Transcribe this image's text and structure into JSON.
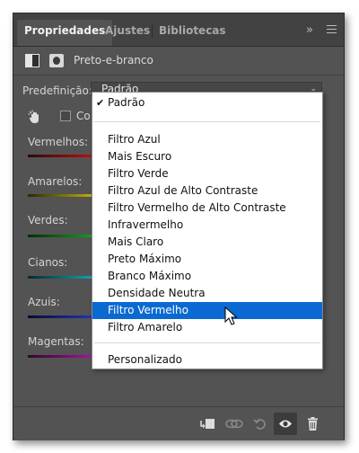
{
  "tabs": [
    {
      "label": "Propriedades",
      "active": true
    },
    {
      "label": "Ajustes",
      "active": false
    },
    {
      "label": "Bibliotecas",
      "active": false
    }
  ],
  "tab_overflow": "»",
  "adjustment": {
    "title": "Preto-e-branco",
    "icons": [
      "adjustment-layer-icon",
      "mask-icon"
    ]
  },
  "preset": {
    "label": "Predefinição:",
    "value": "Padrão"
  },
  "auto": {
    "label": "Co",
    "checked": false
  },
  "sliders": [
    {
      "label": "Vermelhos:",
      "colors": [
        "#2a0a0a",
        "#e01010"
      ]
    },
    {
      "label": "Amarelos:",
      "colors": [
        "#2a2a0a",
        "#e0d010"
      ]
    },
    {
      "label": "Verdes:",
      "colors": [
        "#0a2a0a",
        "#10c020"
      ]
    },
    {
      "label": "Cianos:",
      "colors": [
        "#0a2a2a",
        "#10c0d0"
      ]
    },
    {
      "label": "Azuis:",
      "colors": [
        "#0a0a2a",
        "#2040e0"
      ]
    },
    {
      "label": "Magentas:",
      "colors": [
        "#2a0a2a",
        "#d010c0"
      ]
    }
  ],
  "dropdown": {
    "items": [
      {
        "label": "Padrão",
        "checked": true
      },
      {
        "separator": true
      },
      {
        "label": "Filtro Azul"
      },
      {
        "label": "Mais Escuro"
      },
      {
        "label": "Filtro Verde"
      },
      {
        "label": "Filtro Azul de Alto Contraste"
      },
      {
        "label": "Filtro Vermelho de Alto Contraste"
      },
      {
        "label": "Infravermelho"
      },
      {
        "label": "Mais Claro"
      },
      {
        "label": "Preto Máximo"
      },
      {
        "label": "Branco Máximo"
      },
      {
        "label": "Densidade Neutra"
      },
      {
        "label": "Filtro Vermelho",
        "selected": true
      },
      {
        "label": "Filtro Amarelo"
      },
      {
        "separator": true
      },
      {
        "label": "Personalizado"
      }
    ]
  },
  "footer_icons": [
    "clip-to-layer-icon",
    "view-previous-state-icon",
    "reset-icon",
    "visibility-eye-icon",
    "trash-icon"
  ],
  "colors": {
    "panel": "#535353",
    "tabbar": "#424242",
    "highlight": "#0a6ad2"
  }
}
